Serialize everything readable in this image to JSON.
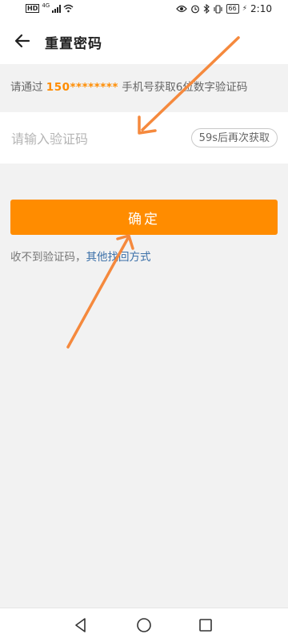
{
  "status_bar": {
    "hd": "HD",
    "network": "4G",
    "battery": "66",
    "time": "2:10"
  },
  "header": {
    "title": "重置密码"
  },
  "hint": {
    "prefix": "请通过 ",
    "phone": "150********",
    "suffix": " 手机号获取6位数字验证码"
  },
  "code_input": {
    "placeholder": "请输入验证码",
    "value": ""
  },
  "resend_button": {
    "label": "59s后再次获取"
  },
  "confirm_button": {
    "label": "确定"
  },
  "help": {
    "text": "收不到验证码，",
    "link": "其他找回方式"
  },
  "colors": {
    "accent": "#ff8c00",
    "link": "#3a6fa8",
    "annotation_arrow": "#f5893d"
  },
  "icons": {
    "back": "arrow-left-icon",
    "nav_back": "triangle-back-icon",
    "nav_home": "circle-home-icon",
    "nav_recent": "square-recent-icon"
  }
}
